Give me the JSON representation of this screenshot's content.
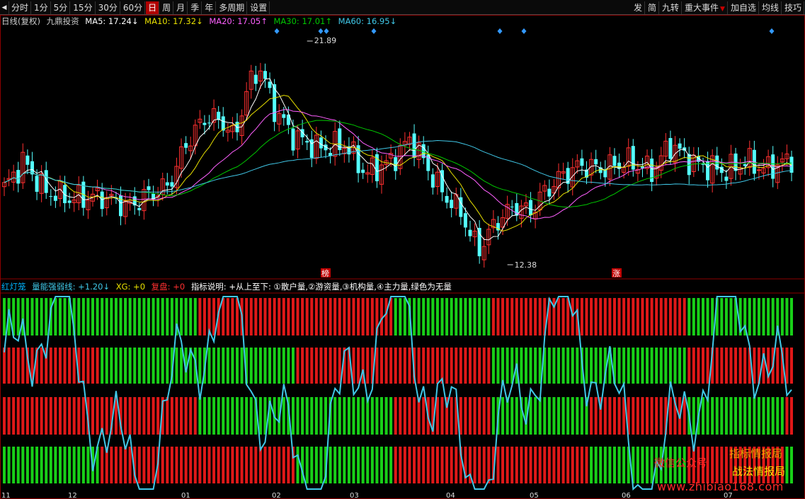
{
  "toolbar": {
    "arrow": "◀",
    "tabs": [
      "分时",
      "1分",
      "5分",
      "15分",
      "30分",
      "60分",
      "日",
      "周",
      "月",
      "季",
      "年",
      "多周期",
      "设置"
    ],
    "active": "日",
    "right": [
      "发",
      "简",
      "九转",
      "重大事件",
      "加自选",
      "均线",
      "技巧"
    ]
  },
  "ma": {
    "label": "日线(复权)",
    "stock": "九鼎投资",
    "ma5": "MA5: 17.24↓",
    "ma10": "MA10: 17.32↓",
    "ma20": "MA20: 17.05↑",
    "ma30": "MA30: 17.01↑",
    "ma60": "MA60: 16.95↓"
  },
  "colors": {
    "ma5": "#ffffff",
    "ma10": "#e8e000",
    "ma20": "#ff60ff",
    "ma30": "#00c800",
    "ma60": "#40c8e8",
    "up": "#ff3030",
    "down": "#54ffff",
    "bar_red": "#e01818",
    "bar_green": "#18d018",
    "marker": "#3399ff"
  },
  "price_high": "21.89",
  "price_low": "12.38",
  "markers": {
    "bang": "榜",
    "zhang": "涨"
  },
  "indicator": {
    "name": "红灯笼",
    "line": "量能强弱线: +1.20↓",
    "xg": "XG: +0",
    "fupan": "复盘: +0",
    "desc": "指标说明: +从上至下: ①散户量,②游资量,③机构量,④主力量,绿色为无量"
  },
  "xaxis": [
    "11",
    "12",
    "01",
    "02",
    "03",
    "04",
    "05",
    "06",
    "07"
  ],
  "watermark": {
    "wechat": "微信公众号",
    "name1": "指标情报局",
    "name2": "战法情报局",
    "url": "www.zhibiao168.com"
  }
}
